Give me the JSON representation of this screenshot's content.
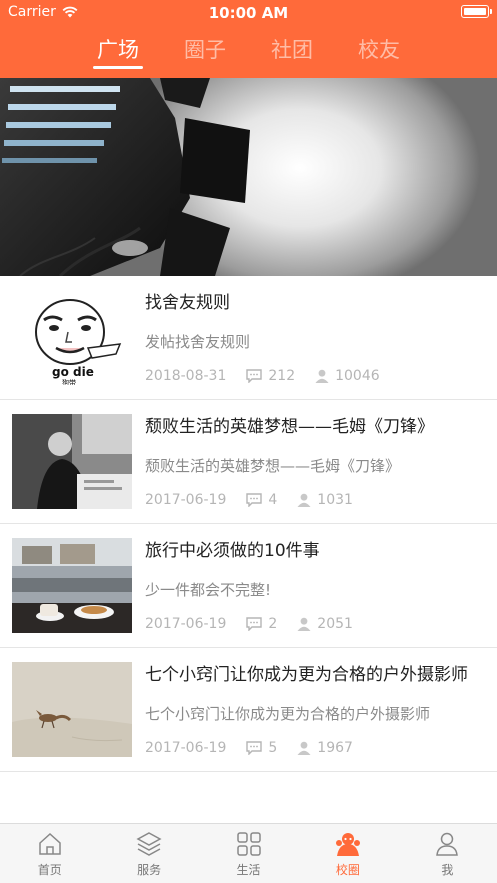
{
  "status": {
    "carrier": "Carrier",
    "time": "10:00 AM"
  },
  "tabs": [
    {
      "label": "广场",
      "active": true
    },
    {
      "label": "圈子",
      "active": false
    },
    {
      "label": "社团",
      "active": false
    },
    {
      "label": "校友",
      "active": false
    }
  ],
  "posts": [
    {
      "title": "找舍友规则",
      "desc": "发帖找舍友规则",
      "date": "2018-08-31",
      "comments": "212",
      "views": "10046",
      "thumb_caption": "go die",
      "thumb_subcaption": "狗带"
    },
    {
      "title": "颓败生活的英雄梦想——毛姆《刀锋》",
      "desc": "颓败生活的英雄梦想——毛姆《刀锋》",
      "date": "2017-06-19",
      "comments": "4",
      "views": "1031"
    },
    {
      "title": "旅行中必须做的10件事",
      "desc": "少一件都会不完整!",
      "date": "2017-06-19",
      "comments": "2",
      "views": "2051"
    },
    {
      "title": "七个小窍门让你成为更为合格的户外摄影师",
      "desc": "七个小窍门让你成为更为合格的户外摄影师",
      "date": "2017-06-19",
      "comments": "5",
      "views": "1967"
    }
  ],
  "tabbar": [
    {
      "label": "首页",
      "icon": "home-icon",
      "active": false
    },
    {
      "label": "服务",
      "icon": "layers-icon",
      "active": false
    },
    {
      "label": "生活",
      "icon": "grid-icon",
      "active": false
    },
    {
      "label": "校圈",
      "icon": "campus-icon",
      "active": true
    },
    {
      "label": "我",
      "icon": "person-icon",
      "active": false
    }
  ],
  "colors": {
    "accent": "#ff6a3a",
    "muted": "#b5b5b5"
  }
}
